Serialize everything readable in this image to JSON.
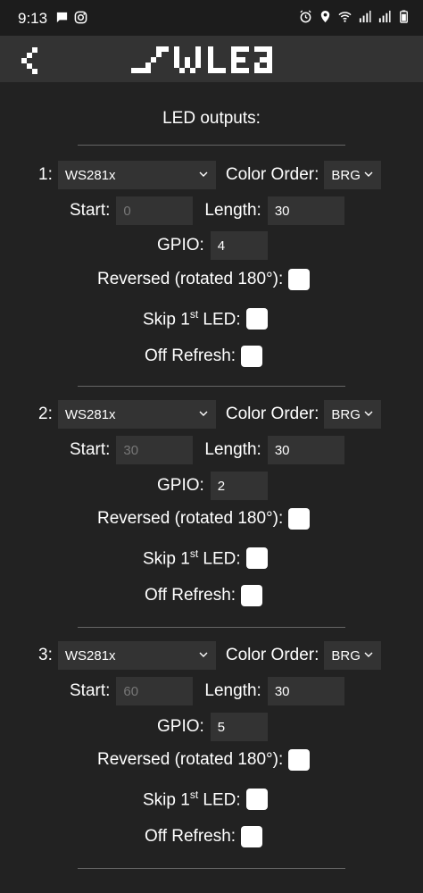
{
  "status": {
    "time": "9:13"
  },
  "page": {
    "title": "LED outputs:"
  },
  "labels": {
    "color_order": "Color Order:",
    "start": "Start:",
    "length": "Length:",
    "gpio": "GPIO:",
    "reversed": "Reversed (rotated 180°):",
    "skip_prefix": "Skip 1",
    "skip_sup": "st",
    "skip_suffix": " LED:",
    "off_refresh": "Off Refresh:"
  },
  "outputs": [
    {
      "number": "1:",
      "type": "WS281x",
      "color_order": "BRG",
      "start": "0",
      "length": "30",
      "gpio": "4"
    },
    {
      "number": "2:",
      "type": "WS281x",
      "color_order": "BRG",
      "start": "30",
      "length": "30",
      "gpio": "2"
    },
    {
      "number": "3:",
      "type": "WS281x",
      "color_order": "BRG",
      "start": "60",
      "length": "30",
      "gpio": "5"
    }
  ]
}
